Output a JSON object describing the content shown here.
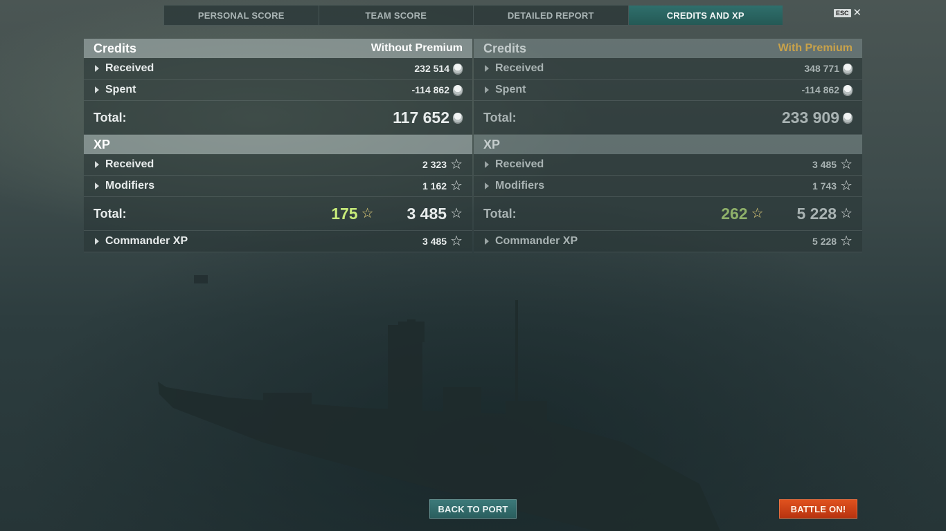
{
  "tabs": [
    {
      "label": "PERSONAL SCORE"
    },
    {
      "label": "TEAM SCORE"
    },
    {
      "label": "DETAILED REPORT"
    },
    {
      "label": "CREDITS AND XP",
      "active": true
    }
  ],
  "esc": {
    "key": "ESC",
    "close": "✕"
  },
  "without_premium": {
    "credits": {
      "title": "Credits",
      "mode": "Without Premium",
      "received": {
        "label": "Received",
        "value": "232 514"
      },
      "spent": {
        "label": "Spent",
        "value": "-114 862"
      },
      "total": {
        "label": "Total:",
        "value": "117 652"
      }
    },
    "xp": {
      "title": "XP",
      "received": {
        "label": "Received",
        "value": "2 323"
      },
      "modifiers": {
        "label": "Modifiers",
        "value": "1 162"
      },
      "total": {
        "label": "Total:",
        "bonus": "175",
        "value": "3 485"
      },
      "commander": {
        "label": "Commander XP",
        "value": "3 485"
      }
    }
  },
  "with_premium": {
    "credits": {
      "title": "Credits",
      "mode": "With Premium",
      "received": {
        "label": "Received",
        "value": "348 771"
      },
      "spent": {
        "label": "Spent",
        "value": "-114 862"
      },
      "total": {
        "label": "Total:",
        "value": "233 909"
      }
    },
    "xp": {
      "title": "XP",
      "received": {
        "label": "Received",
        "value": "3 485"
      },
      "modifiers": {
        "label": "Modifiers",
        "value": "1 743"
      },
      "total": {
        "label": "Total:",
        "bonus": "262",
        "value": "5 228"
      },
      "commander": {
        "label": "Commander XP",
        "value": "5 228"
      }
    }
  },
  "buttons": {
    "back_to_port": "BACK TO PORT",
    "battle_on": "BATTLE ON!"
  },
  "icons": {
    "credit": "credit-coin-icon",
    "xp": "star-icon",
    "free_xp_bonus": "gold-star-icon"
  },
  "colors": {
    "active_tab": "#2f6f6c",
    "battle_button": "#d84a1a",
    "premium_label": "#c9a24a",
    "bonus_xp": "#c8ec7a"
  }
}
